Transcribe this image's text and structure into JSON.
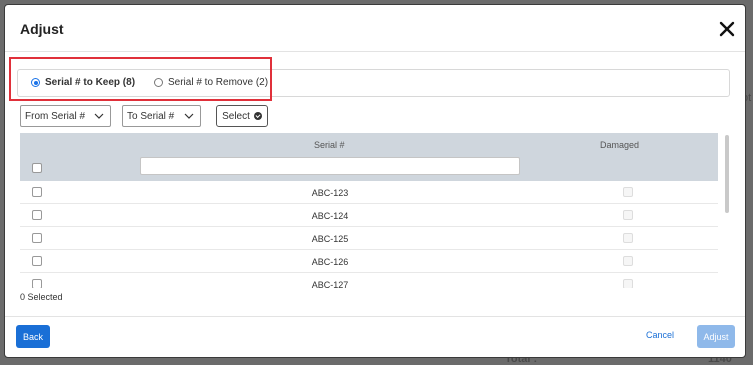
{
  "background": {
    "partial_text_1": "ot",
    "partial_text_2": "Total :",
    "partial_text_3": "1140"
  },
  "dialog": {
    "title": "Adjust",
    "close_icon": "close-icon"
  },
  "radio_options": [
    {
      "label": "Serial # to Keep (8)",
      "selected": true
    },
    {
      "label": "Serial # to Remove (2)",
      "selected": false
    }
  ],
  "filters": {
    "from_serial": "From Serial #",
    "to_serial": "To Serial #",
    "select_label": "Select"
  },
  "table": {
    "columns": [
      "Serial #",
      "Damaged"
    ],
    "rows": [
      {
        "serial": "ABC-123"
      },
      {
        "serial": "ABC-124"
      },
      {
        "serial": "ABC-125"
      },
      {
        "serial": "ABC-126"
      },
      {
        "serial": "ABC-127"
      }
    ]
  },
  "selected_count": "0 Selected",
  "footer": {
    "back_label": "Back",
    "cancel_label": "Cancel",
    "adjust_label": "Adjust"
  },
  "colors": {
    "primary": "#1a6fd6",
    "primary_disabled": "#8fb9ea",
    "highlight": "#e0303a",
    "table_header": "#cfd6dd"
  }
}
